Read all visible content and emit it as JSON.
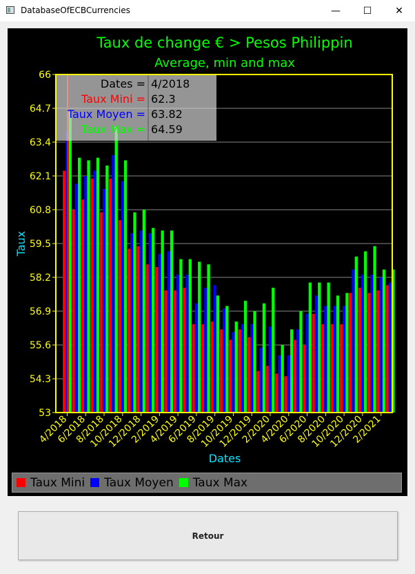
{
  "window": {
    "title": "DatabaseOfECBCurrencies",
    "minimize": "—",
    "maximize": "☐",
    "close": "✕",
    "icon": "app-window-icon"
  },
  "button": {
    "retour": "Retour"
  },
  "tooltip": {
    "rows": [
      {
        "label": "Dates",
        "value": "4/2018",
        "color": "#000000"
      },
      {
        "label": "Taux Mini",
        "value": "62.3",
        "color": "#ff0000"
      },
      {
        "label": "Taux Moyen",
        "value": "63.82",
        "color": "#0000ff"
      },
      {
        "label": "Taux Max",
        "value": "64.59",
        "color": "#00ff00"
      }
    ]
  },
  "colors": {
    "mini": "#ff0000",
    "moyen": "#0000ff",
    "max": "#00ff00",
    "title": "#00ff00",
    "axis": "#ffff00",
    "axis_label": "#00e5ff"
  },
  "chart_data": {
    "type": "bar",
    "title": "Taux de change € > Pesos Philippin",
    "subtitle": "Average, min and max",
    "xlabel": "Dates",
    "ylabel": "Taux",
    "ylim": [
      53,
      66
    ],
    "yticks": [
      "53",
      "54.3",
      "55.6",
      "56.9",
      "58.2",
      "59.5",
      "60.8",
      "62.1",
      "63.4",
      "64.7",
      "66"
    ],
    "grid": true,
    "legend": "bottom",
    "categories": [
      "4/2018",
      "5/2018",
      "6/2018",
      "7/2018",
      "8/2018",
      "9/2018",
      "10/2018",
      "11/2018",
      "12/2018",
      "1/2019",
      "2/2019",
      "3/2019",
      "4/2019",
      "5/2019",
      "6/2019",
      "7/2019",
      "8/2019",
      "9/2019",
      "10/2019",
      "11/2019",
      "12/2019",
      "1/2020",
      "2/2020",
      "3/2020",
      "4/2020",
      "5/2020",
      "6/2020",
      "7/2020",
      "8/2020",
      "9/2020",
      "10/2020",
      "11/2020",
      "12/2020",
      "1/2021",
      "2/2021",
      "3/2021"
    ],
    "tick_labels": [
      "4/2018",
      "6/2018",
      "8/2018",
      "10/2018",
      "12/2018",
      "2/2019",
      "4/2019",
      "6/2019",
      "8/2019",
      "10/2019",
      "12/2019",
      "2/2020",
      "4/2020",
      "6/2020",
      "8/2020",
      "10/2020",
      "12/2020",
      "2/2021"
    ],
    "series": [
      {
        "name": "Taux Mini",
        "values": [
          62.3,
          60.8,
          61.2,
          62.0,
          60.7,
          62.0,
          60.4,
          59.3,
          59.4,
          58.7,
          58.6,
          57.7,
          57.7,
          57.8,
          56.4,
          56.4,
          56.5,
          56.2,
          55.8,
          56.2,
          55.9,
          54.6,
          54.8,
          54.5,
          54.4,
          55.8,
          55.6,
          56.8,
          56.4,
          56.4,
          56.4,
          57.6,
          57.8,
          57.6,
          57.7,
          57.9
        ]
      },
      {
        "name": "Taux Moyen",
        "values": [
          63.82,
          61.8,
          62.1,
          62.3,
          61.6,
          62.9,
          61.9,
          59.9,
          60.0,
          59.9,
          59.1,
          59.2,
          58.3,
          58.3,
          57.2,
          57.8,
          57.9,
          57.0,
          56.1,
          56.4,
          56.4,
          55.5,
          56.3,
          55.2,
          55.2,
          56.2,
          56.8,
          57.5,
          57.1,
          57.1,
          57.1,
          58.5,
          58.3,
          58.3,
          58.2,
          58.0
        ]
      },
      {
        "name": "Taux Max",
        "values": [
          64.59,
          62.8,
          62.7,
          62.8,
          62.5,
          64.0,
          62.7,
          60.7,
          60.8,
          60.1,
          60.0,
          60.0,
          58.9,
          58.9,
          58.8,
          58.7,
          57.5,
          57.1,
          56.5,
          57.3,
          56.9,
          57.2,
          57.8,
          55.6,
          56.2,
          56.9,
          58.0,
          58.0,
          58.0,
          57.5,
          57.6,
          59.0,
          59.2,
          59.4,
          58.5,
          58.5
        ]
      }
    ]
  }
}
